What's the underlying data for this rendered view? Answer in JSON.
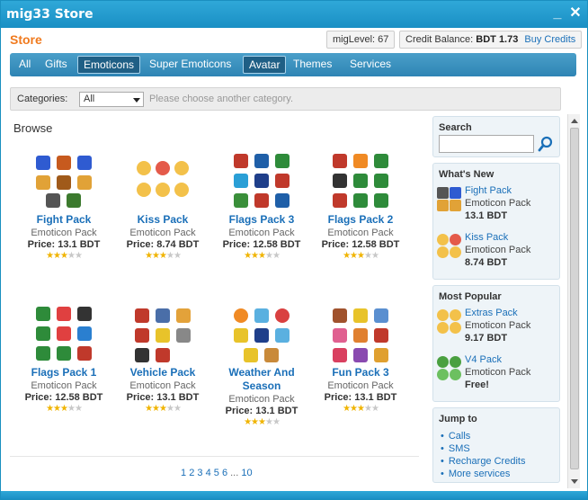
{
  "window": {
    "title": "mig33 Store",
    "minimize_label": "_",
    "close_label": "✕"
  },
  "header": {
    "store_title": "Store",
    "miglevel_label": "migLevel:",
    "miglevel_value": "67",
    "credit_label": "Credit Balance:",
    "credit_value": "BDT 1.73",
    "buy_label": "Buy Credits"
  },
  "nav": {
    "tabs": [
      {
        "label": "All"
      },
      {
        "label": "Gifts"
      },
      {
        "label": "Emoticons",
        "active": true
      },
      {
        "label": "Super Emoticons"
      },
      {
        "label": "Avatar",
        "active": true
      },
      {
        "label": "Themes"
      },
      {
        "label": "Services"
      }
    ]
  },
  "categories": {
    "label": "Categories:",
    "selected": "All",
    "hint": "Please choose another category."
  },
  "browse": {
    "title": "Browse",
    "items": [
      {
        "name": "Fight Pack",
        "type": "Emoticon Pack",
        "price": "Price: 13.1 BDT",
        "stars": 3
      },
      {
        "name": "Kiss Pack",
        "type": "Emoticon Pack",
        "price": "Price: 8.74 BDT",
        "stars": 3
      },
      {
        "name": "Flags Pack 3",
        "type": "Emoticon Pack",
        "price": "Price: 12.58 BDT",
        "stars": 3
      },
      {
        "name": "Flags Pack 2",
        "type": "Emoticon Pack",
        "price": "Price: 12.58 BDT",
        "stars": 3
      },
      {
        "name": "Flags Pack 1",
        "type": "Emoticon Pack",
        "price": "Price: 12.58 BDT",
        "stars": 3
      },
      {
        "name": "Vehicle Pack",
        "type": "Emoticon Pack",
        "price": "Price: 13.1 BDT",
        "stars": 3
      },
      {
        "name": "Weather And Season",
        "type": "Emoticon Pack",
        "price": "Price: 13.1 BDT",
        "stars": 3
      },
      {
        "name": "Fun Pack 3",
        "type": "Emoticon Pack",
        "price": "Price: 13.1 BDT",
        "stars": 3
      }
    ],
    "star_max": 5,
    "pager": {
      "pages": [
        "1",
        "2",
        "3",
        "4",
        "5",
        "6"
      ],
      "ellipsis": "...",
      "last": "10"
    }
  },
  "sidebar": {
    "search_label": "Search",
    "whats_new": {
      "title": "What's New",
      "entries": [
        {
          "name": "Fight Pack",
          "type": "Emoticon Pack",
          "price": "13.1 BDT"
        },
        {
          "name": "Kiss Pack",
          "type": "Emoticon Pack",
          "price": "8.74 BDT"
        }
      ]
    },
    "most_popular": {
      "title": "Most Popular",
      "entries": [
        {
          "name": "Extras Pack",
          "type": "Emoticon Pack",
          "price": "9.17 BDT"
        },
        {
          "name": "V4 Pack",
          "type": "Emoticon Pack",
          "price": "Free!"
        }
      ]
    },
    "jump_to": {
      "title": "Jump to",
      "links": [
        "Calls",
        "SMS",
        "Recharge Credits",
        "More services"
      ]
    }
  },
  "colors": {
    "titlebar": "#1a8fc4",
    "store_orange": "#f07a1e",
    "link_blue": "#1a6fb8",
    "nav_bg": "#2e84b4",
    "star_on": "#f0b400"
  }
}
